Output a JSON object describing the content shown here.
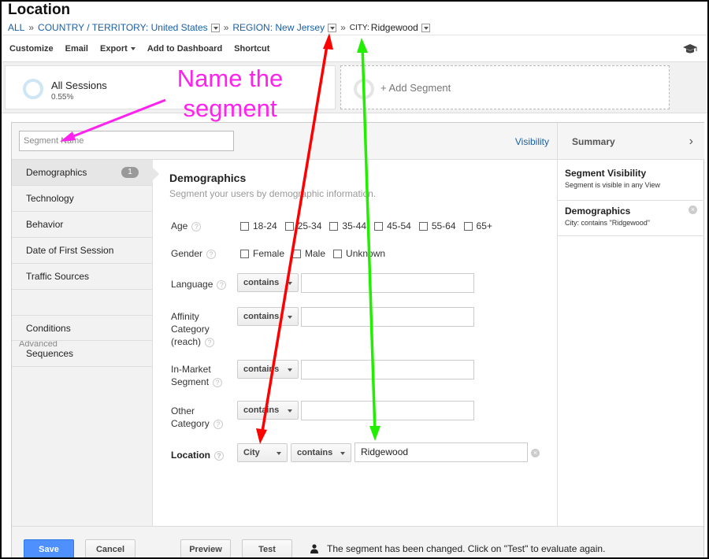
{
  "page": {
    "title": "Location"
  },
  "breadcrumb": {
    "all": "ALL",
    "sep": "»",
    "country": "COUNTRY / TERRITORY: United States",
    "region": "REGION: New Jersey",
    "city_key": "CITY:",
    "city_value": "Ridgewood"
  },
  "toolbar": {
    "customize": "Customize",
    "email": "Email",
    "export": "Export",
    "add_to_dashboard": "Add to Dashboard",
    "shortcut": "Shortcut"
  },
  "segments": {
    "current": {
      "name": "All Sessions",
      "percent": "0.55%"
    },
    "add_label": "+ Add Segment"
  },
  "editor": {
    "name_placeholder": "Segment Name",
    "visibility_link": "Visibility",
    "nav": {
      "items": [
        "Demographics",
        "Technology",
        "Behavior",
        "Date of First Session",
        "Traffic Sources"
      ],
      "demographics_badge": "1",
      "advanced_group": "Advanced",
      "advanced_items": [
        "Conditions",
        "Sequences"
      ]
    },
    "section": {
      "title": "Demographics",
      "subtitle": "Segment your users by demographic information."
    },
    "fields": {
      "age_label": "Age",
      "age_options": [
        "18-24",
        "25-34",
        "35-44",
        "45-54",
        "55-64",
        "65+"
      ],
      "gender_label": "Gender",
      "gender_options": [
        "Female",
        "Male",
        "Unknown"
      ],
      "language_label": "Language",
      "affinity_label_1": "Affinity",
      "affinity_label_2": "Category",
      "affinity_label_3": "(reach)",
      "inmarket_label_1": "In-Market",
      "inmarket_label_2": "Segment",
      "other_label_1": "Other",
      "other_label_2": "Category",
      "location_label": "Location",
      "operator": "contains",
      "location_dimension": "City",
      "location_value": "Ridgewood"
    },
    "summary": {
      "header": "Summary",
      "visibility_title": "Segment Visibility",
      "visibility_desc": "Segment is visible in any View",
      "demo_title": "Demographics",
      "demo_desc": "City: contains \"Ridgewood\""
    },
    "footer": {
      "save": "Save",
      "cancel": "Cancel",
      "preview": "Preview",
      "test": "Test",
      "notice": "The segment has been changed. Click on \"Test\" to evaluate again."
    }
  },
  "annotation": {
    "line1": "Name the",
    "line2": "segment"
  },
  "colors": {
    "link": "#1a5fa5",
    "primary_button": "#4d90fe",
    "annotation_magenta": "#ff22ee",
    "arrow_red": "#ff0000",
    "arrow_green": "#22ee00"
  },
  "icons": {
    "toolbar_right": "graduation-cap-icon",
    "summary_expand": "chevron-right-icon",
    "notice": "person-icon"
  }
}
